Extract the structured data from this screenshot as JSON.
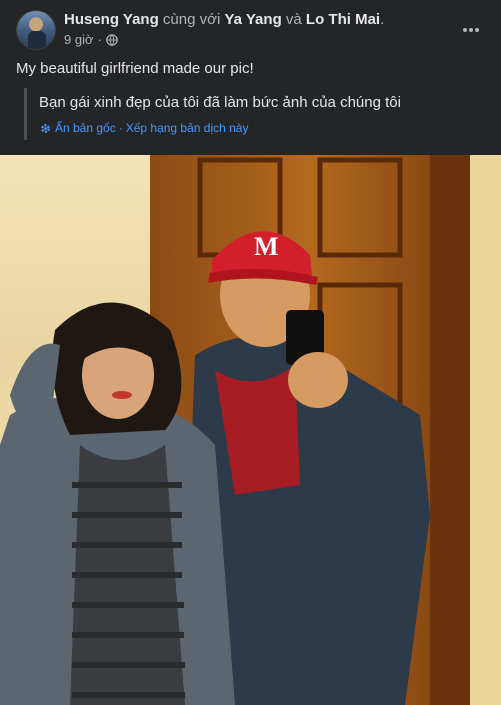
{
  "post": {
    "author": "Huseng Yang",
    "with_text": "cùng với",
    "tagged_1": "Ya Yang",
    "and_text": "và",
    "tagged_2": "Lo Thi Mai",
    "period": ".",
    "time": "9 giờ",
    "dot": "·",
    "audience_icon": "globe-icon",
    "more_icon": "more-horizontal-icon",
    "text": "My beautiful girlfriend made our pic!"
  },
  "translation": {
    "text": "Bạn gái xinh đẹp của tôi đã làm bức ảnh của chúng tôi",
    "settings_icon": "gear-icon",
    "hide_original": "Ẩn bản gốc",
    "separator": "·",
    "rate": "Xếp hạng bản dịch này"
  },
  "colors": {
    "background": "#242526",
    "primary_text": "#e4e6eb",
    "secondary_text": "#b0b3b8",
    "link": "#4599ff"
  }
}
